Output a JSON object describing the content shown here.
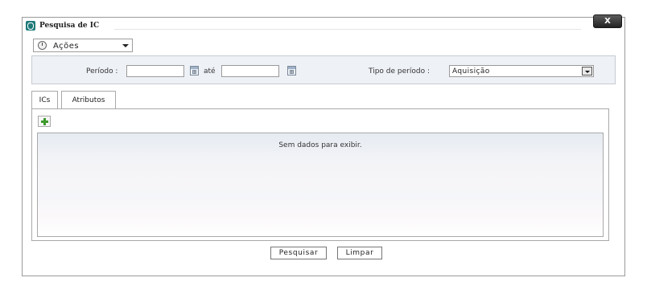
{
  "dialog": {
    "title": "Pesquisa de IC",
    "close_label": "X"
  },
  "actions_menu": {
    "label": "Ações",
    "icon": "actions-gear-icon"
  },
  "filters": {
    "period_label": "Período :",
    "period_start_value": "",
    "period_between_label": "até",
    "period_end_value": "",
    "period_type_label": "Tipo de período :",
    "period_type_selected": "Aquisição"
  },
  "tabs": [
    {
      "label": "ICs",
      "active": false
    },
    {
      "label": "Atributos",
      "active": true
    }
  ],
  "attributes_tab": {
    "add_icon": "plus-icon",
    "empty_message": "Sem dados para exibir."
  },
  "footer": {
    "search_label": "Pesquisar",
    "clear_label": "Limpar"
  },
  "colors": {
    "title_icon": "#1f7a7a",
    "filter_bar_bg": "#eef1f6",
    "add_icon_green": "#3c9a2a",
    "close_button_bg": "#222222"
  }
}
